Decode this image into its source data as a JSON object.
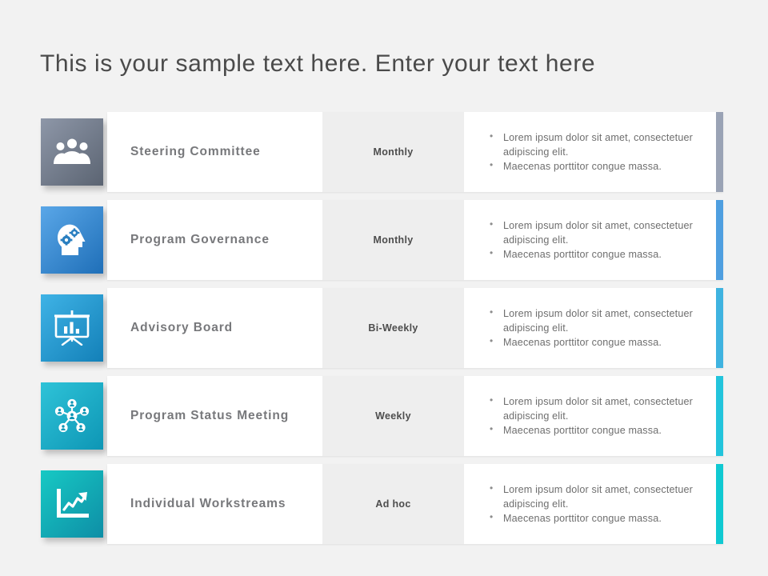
{
  "slide": {
    "title": "This is your sample text here. Enter your text here",
    "background_color": "#f2f2f2"
  },
  "rows": [
    {
      "name": "Steering Committee",
      "frequency": "Monthly",
      "icon": "people-group-icon",
      "accent_color": "#9aa3b5",
      "tile_gradient_from": "#8e97a8",
      "tile_gradient_to": "#5b6472",
      "bullets": [
        "Lorem ipsum dolor sit amet, consectetuer adipiscing elit.",
        "Maecenas porttitor congue massa."
      ]
    },
    {
      "name": "Program Governance",
      "frequency": "Monthly",
      "icon": "head-with-gears-icon",
      "accent_color": "#4f9fe0",
      "tile_gradient_from": "#5aa7e8",
      "tile_gradient_to": "#1f6fb8",
      "bullets": [
        "Lorem ipsum dolor sit amet, consectetuer adipiscing elit.",
        "Maecenas porttitor congue massa."
      ]
    },
    {
      "name": "Advisory Board",
      "frequency": "Bi-Weekly",
      "icon": "presentation-board-icon",
      "accent_color": "#3fb3e0",
      "tile_gradient_from": "#3fb3e6",
      "tile_gradient_to": "#1380b8",
      "bullets": [
        "Lorem ipsum dolor sit amet, consectetuer adipiscing elit.",
        "Maecenas porttitor congue massa."
      ]
    },
    {
      "name": "Program Status Meeting",
      "frequency": "Weekly",
      "icon": "network-hub-icon",
      "accent_color": "#22c4dc",
      "tile_gradient_from": "#2ec3d8",
      "tile_gradient_to": "#0e96b5",
      "bullets": [
        "Lorem ipsum dolor sit amet, consectetuer adipiscing elit.",
        "Maecenas porttitor congue massa."
      ]
    },
    {
      "name": "Individual Workstreams",
      "frequency": "Ad hoc",
      "icon": "growth-chart-icon",
      "accent_color": "#10c9d2",
      "tile_gradient_from": "#17c9c4",
      "tile_gradient_to": "#0e8ea6",
      "bullets": [
        "Lorem ipsum dolor sit amet, consectetuer adipiscing elit.",
        "Maecenas porttitor congue massa."
      ]
    }
  ]
}
